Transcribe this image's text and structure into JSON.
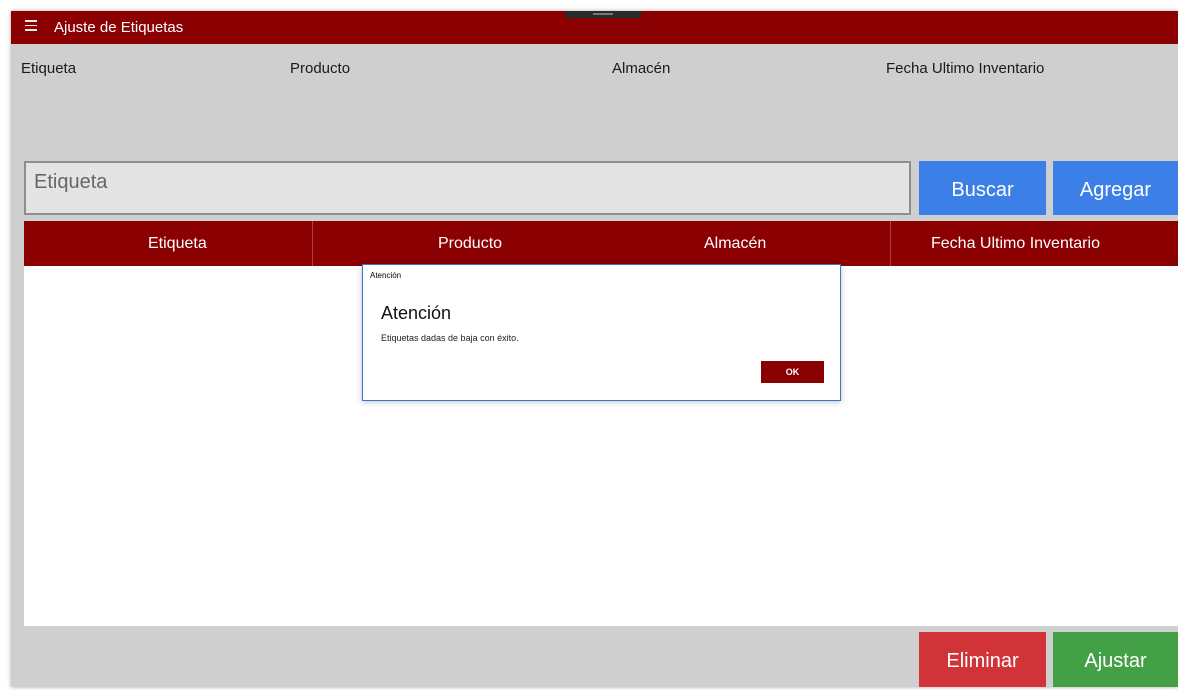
{
  "window": {
    "title": "Ajuste de Etiquetas"
  },
  "info": {
    "etiqueta_label": "Etiqueta",
    "producto_label": "Producto",
    "almacen_label": "Almacén",
    "fecha_label": "Fecha Ultimo Inventario"
  },
  "search": {
    "placeholder": "Etiqueta",
    "value": ""
  },
  "buttons": {
    "buscar": "Buscar",
    "agregar": "Agregar",
    "eliminar": "Eliminar",
    "ajustar": "Ajustar"
  },
  "table": {
    "columns": [
      "Etiqueta",
      "Producto",
      "Almacén",
      "Fecha Ultimo Inventario"
    ],
    "rows": []
  },
  "dialog": {
    "titlebar": "Atención",
    "heading": "Atención",
    "message": "Etiquetas dadas de baja con éxito.",
    "ok_label": "OK"
  },
  "colors": {
    "header": "#8b0000",
    "buscar": "#3c7fe6",
    "eliminar": "#d13438",
    "ajustar": "#43a047"
  }
}
